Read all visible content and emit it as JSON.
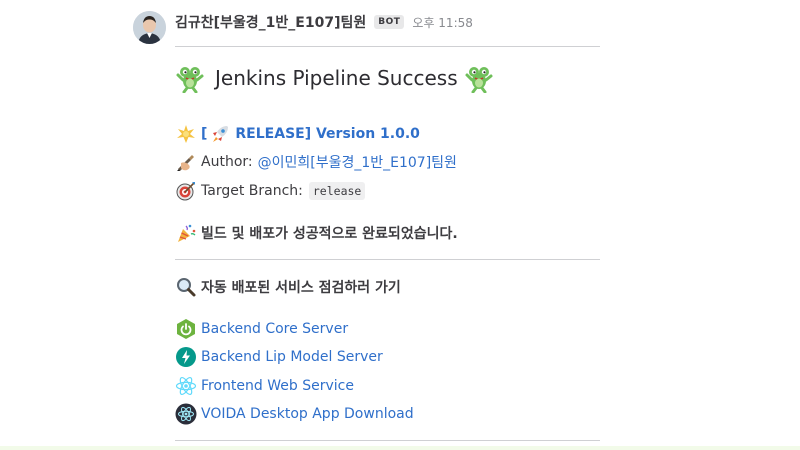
{
  "message": {
    "sender": "김규찬[부울경_1반_E107]팀원",
    "badge": "BOT",
    "time": "오후 11:58"
  },
  "title": {
    "text": "Jenkins Pipeline Success",
    "left_icon": "frog-dancing-icon",
    "right_icon": "frog-dancing-icon"
  },
  "release": {
    "icon1": "star-burst-icon",
    "icon2": "rocket-icon",
    "prefix": "[",
    "link_text": "🚀 RELEASE] Version 1.0.0",
    "display": "RELEASE] Version 1.0.0"
  },
  "author": {
    "icon": "writing-hand-icon",
    "label": "Author:",
    "mention": "@이민희[부울경_1반_E107]팀원"
  },
  "branch": {
    "icon": "target-icon",
    "label": "Target Branch:",
    "value": "release"
  },
  "status": {
    "icon": "party-popper-icon",
    "text": "빌드 및 배포가 성공적으로 완료되었습니다."
  },
  "services": {
    "icon": "magnifier-icon",
    "heading": "자동 배포된 서비스 점검하러 가기",
    "items": [
      {
        "label": "Backend Core Server",
        "icon": "spring-boot-icon"
      },
      {
        "label": "Backend Lip Model Server",
        "icon": "fastapi-icon"
      },
      {
        "label": "Frontend Web Service",
        "icon": "react-icon"
      },
      {
        "label": "VOIDA Desktop App Download",
        "icon": "electron-icon"
      }
    ]
  },
  "colors": {
    "link": "#2f6fca",
    "divider": "#cfd0d3",
    "spring": "#6db33f",
    "fastapi": "#05998b",
    "react": "#61dafb"
  }
}
